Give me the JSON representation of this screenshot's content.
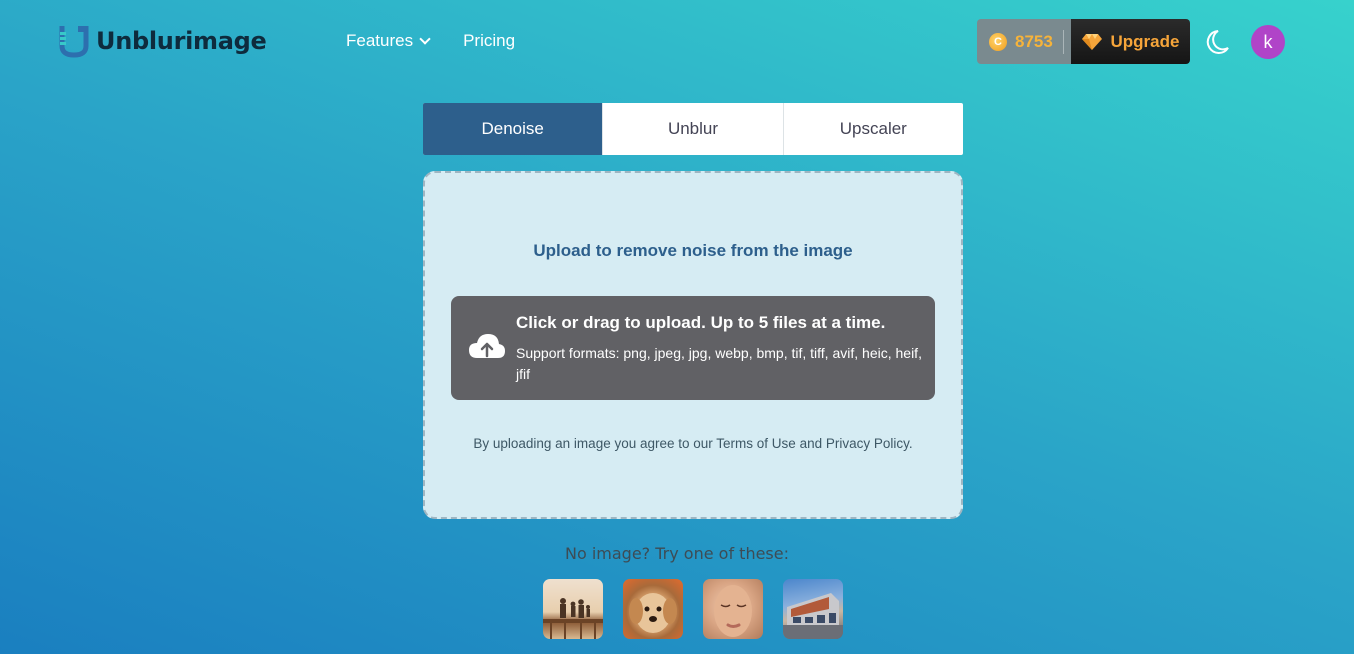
{
  "header": {
    "brand": "Unblurimage",
    "nav": [
      {
        "label": "Features",
        "has_dropdown": true
      },
      {
        "label": "Pricing",
        "has_dropdown": false
      }
    ],
    "credits": "8753",
    "coin_symbol": "C",
    "upgrade_label": "Upgrade",
    "avatar_initial": "k",
    "colors": {
      "upgrade_text": "#f6a53a",
      "avatar_bg": "#b044c8",
      "active_tab": "#2d5f8c"
    }
  },
  "tabs": [
    {
      "label": "Denoise",
      "active": true
    },
    {
      "label": "Unblur",
      "active": false
    },
    {
      "label": "Upscaler",
      "active": false
    }
  ],
  "upload": {
    "title": "Upload to remove noise from the image",
    "button_main": "Click or drag to upload. Up to 5 files at a time.",
    "button_sub": "Support formats: png, jpeg, jpg, webp, bmp, tif, tiff, avif, heic, heif, jfif",
    "agree_prefix": "By uploading an image you agree to our ",
    "terms_link": "Terms of Use",
    "agree_and": " and ",
    "privacy_link": "Privacy Policy",
    "agree_suffix": "."
  },
  "samples": {
    "title": "No image? Try one of these:",
    "items": [
      "family-on-pier",
      "puppy",
      "woman-face",
      "modern-building"
    ]
  }
}
